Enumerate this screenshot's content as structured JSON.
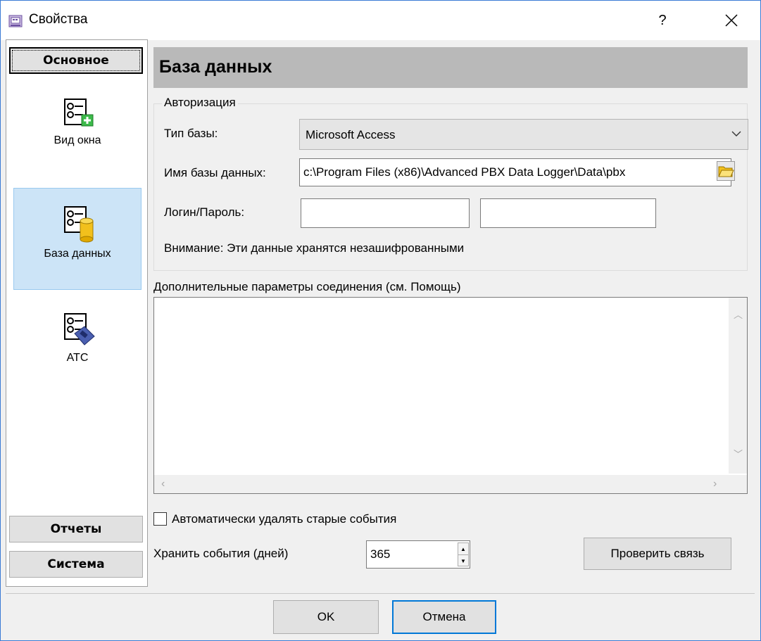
{
  "window": {
    "title": "Свойства",
    "help_glyph": "?"
  },
  "sidebar": {
    "top_button": "Основное",
    "items": [
      {
        "label": "Вид окна",
        "icon": "list-add-icon"
      },
      {
        "label": "База данных",
        "icon": "list-database-icon",
        "selected": true
      },
      {
        "label": "АТС",
        "icon": "list-pbx-icon"
      }
    ],
    "bottom_buttons": [
      "Отчеты",
      "Система"
    ]
  },
  "main": {
    "title": "База данных",
    "auth": {
      "legend": "Авторизация",
      "db_type_label": "Тип базы:",
      "db_type_value": "Microsoft Access",
      "db_name_label": "Имя базы данных:",
      "db_name_value": "c:\\Program Files (x86)\\Advanced PBX Data Logger\\Data\\pbx",
      "login_label": "Логин/Пароль:",
      "login_value": "",
      "password_value": "",
      "warning": "Внимание: Эти данные хранятся незашифрованными"
    },
    "params": {
      "label": "Дополнительные параметры соединения (см. Помощь)",
      "value": ""
    },
    "auto_delete": {
      "label": "Автоматически удалять старые события",
      "checked": false
    },
    "keep_days": {
      "label": "Хранить события (дней)",
      "value": "365"
    },
    "test_button": "Проверить связь"
  },
  "footer": {
    "ok": "OK",
    "cancel": "Отмена"
  },
  "colors": {
    "accent": "#0078d7",
    "selected_bg": "#cce4f7",
    "header_bg": "#b9b9b9"
  }
}
